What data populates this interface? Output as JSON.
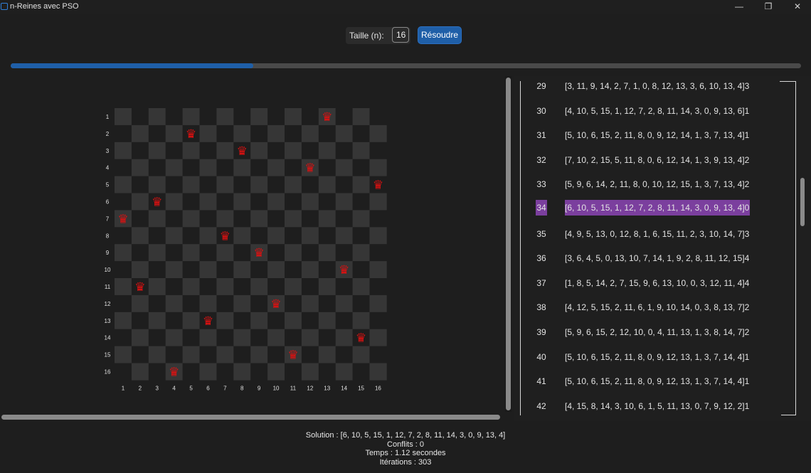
{
  "window": {
    "title": "n-Reines avec PSO",
    "minimize_glyph": "—",
    "maximize_glyph": "❐",
    "close_glyph": "✕"
  },
  "toolbar": {
    "size_label": "Taille (n):",
    "size_value": "16",
    "solve_label": "Résoudre"
  },
  "progress": {
    "value": 0.307
  },
  "board": {
    "n": 16,
    "row_labels": [
      "1",
      "2",
      "3",
      "4",
      "5",
      "6",
      "7",
      "8",
      "9",
      "10",
      "11",
      "12",
      "13",
      "14",
      "15",
      "16"
    ],
    "col_labels": [
      "1",
      "2",
      "3",
      "4",
      "5",
      "6",
      "7",
      "8",
      "9",
      "10",
      "11",
      "12",
      "13",
      "14",
      "15",
      "16"
    ],
    "queen_columns": [
      13,
      5,
      8,
      12,
      16,
      3,
      1,
      7,
      9,
      14,
      2,
      10,
      6,
      15,
      11,
      4
    ],
    "queen_glyph": "♛",
    "queen_color": "#e01010",
    "light_color": "#363636",
    "dark_color": "#1e1e1e"
  },
  "history": {
    "rows": [
      {
        "iter": "29",
        "solution": "[3, 11, 9, 14, 2, 7, 1, 0, 8, 12, 13, 3, 6, 10, 13, 4]",
        "conflicts": "3"
      },
      {
        "iter": "30",
        "solution": "[4, 10, 5, 15, 1, 12, 7, 2, 8, 11, 14, 3, 0, 9, 13, 6]",
        "conflicts": "1"
      },
      {
        "iter": "31",
        "solution": "[5, 10, 6, 15, 2, 11, 8, 0, 9, 12, 14, 1, 3, 7, 13, 4]",
        "conflicts": "1"
      },
      {
        "iter": "32",
        "solution": "[7, 10, 2, 15, 5, 11, 8, 0, 6, 12, 14, 1, 3, 9, 13, 4]",
        "conflicts": "2"
      },
      {
        "iter": "33",
        "solution": "[5, 9, 6, 14, 2, 11, 8, 0, 10, 12, 15, 1, 3, 7, 13, 4]",
        "conflicts": "2"
      },
      {
        "iter": "34",
        "solution": "[6, 10, 5, 15, 1, 12, 7, 2, 8, 11, 14, 3, 0, 9, 13, 4]",
        "conflicts": "0",
        "highlight": true
      },
      {
        "iter": "35",
        "solution": "[4, 9, 5, 13, 0, 12, 8, 1, 6, 15, 11, 2, 3, 10, 14, 7]",
        "conflicts": "3"
      },
      {
        "iter": "36",
        "solution": "[3, 6, 4, 5, 0, 13, 10, 7, 14, 1, 9, 2, 8, 11, 12, 15]",
        "conflicts": "4"
      },
      {
        "iter": "37",
        "solution": "[1, 8, 5, 14, 2, 7, 15, 9, 6, 13, 10, 0, 3, 12, 11, 4]",
        "conflicts": "4"
      },
      {
        "iter": "38",
        "solution": "[4, 12, 5, 15, 2, 11, 6, 1, 9, 10, 14, 0, 3, 8, 13, 7]",
        "conflicts": "2"
      },
      {
        "iter": "39",
        "solution": "[5, 9, 6, 15, 2, 12, 10, 0, 4, 11, 13, 1, 3, 8, 14, 7]",
        "conflicts": "2"
      },
      {
        "iter": "40",
        "solution": "[5, 10, 6, 15, 2, 11, 8, 0, 9, 12, 13, 1, 3, 7, 14, 4]",
        "conflicts": "1"
      },
      {
        "iter": "41",
        "solution": "[5, 10, 6, 15, 2, 11, 8, 0, 9, 12, 13, 1, 3, 7, 14, 4]",
        "conflicts": "1"
      },
      {
        "iter": "42",
        "solution": "[4, 15, 8, 14, 3, 10, 6, 1, 5, 11, 13, 0, 7, 9, 12, 2]",
        "conflicts": "1"
      }
    ]
  },
  "status": {
    "solution": "Solution : [6, 10, 5, 15, 1, 12, 7, 2, 8, 11, 14, 3, 0, 9, 13, 4]",
    "conflicts": "Conflits : 0",
    "time": "Temps : 1.12 secondes",
    "iterations": "Itérations : 303"
  }
}
